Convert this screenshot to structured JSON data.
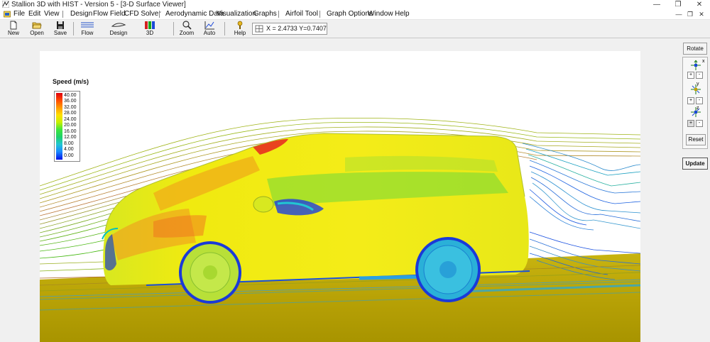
{
  "window": {
    "title": "Stallion 3D with HIST - Version 5 - [3-D Surface Viewer]",
    "minimize_glyph": "—",
    "restore_glyph": "❐",
    "close_glyph": "✕"
  },
  "menu": {
    "items": [
      "File",
      "Edit",
      "View",
      "Design",
      "Flow Field",
      "CFD Solver",
      "Aerodynamic Data",
      "Visualization",
      "Graphs",
      "Airfoil Tool",
      "Graph Options",
      "Window",
      "Help"
    ],
    "mdi_minimize": "—",
    "mdi_restore": "❐",
    "mdi_close": "✕"
  },
  "toolbar": {
    "new_label": "New",
    "open_label": "Open",
    "save_label": "Save",
    "flow_label": "Flow",
    "design_label": "Design",
    "view3d_label": "3D",
    "zoom_label": "Zoom",
    "auto_label": "Auto",
    "help_label": "Help",
    "coordinates": "X = 2.4733  Y=0.7407"
  },
  "legend": {
    "title": "Speed (m/s)",
    "labels": [
      "40.00",
      "36.00",
      "32.00",
      "28.00",
      "24.00",
      "20.00",
      "16.00",
      "12.00",
      "8.00",
      "4.00",
      "0.00"
    ],
    "colors": [
      "#e0000e",
      "#ff4a00",
      "#ff9a00",
      "#ffe000",
      "#c8f000",
      "#3ee63e",
      "#1ed06a",
      "#22c6d2",
      "#1a8aff",
      "#0010e8"
    ]
  },
  "right_panel": {
    "rotate_label": "Rotate",
    "x_axis_label": "x",
    "y_axis_label": "y",
    "z_axis_label": "z",
    "plus": "+",
    "minus": "-",
    "reset_label": "Reset",
    "update_label": "Update"
  }
}
